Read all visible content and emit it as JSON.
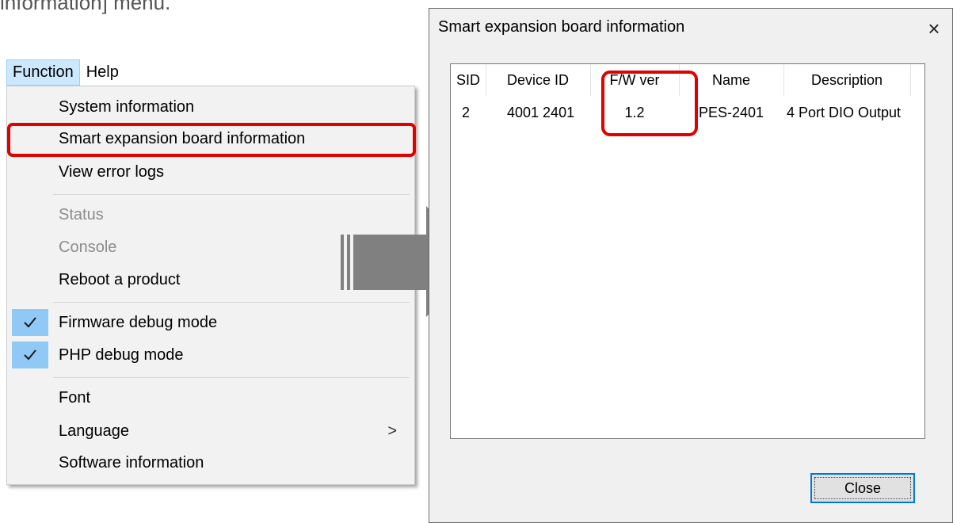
{
  "caption": "information] menu.",
  "menubar": {
    "items": [
      "Function",
      "Help"
    ]
  },
  "menu": {
    "items": [
      {
        "label": "System information",
        "enabled": true
      },
      {
        "label": "Smart expansion board information",
        "enabled": true,
        "highlighted": true
      },
      {
        "label": "View error logs",
        "enabled": true
      },
      {
        "label": "Status",
        "enabled": false
      },
      {
        "label": "Console",
        "enabled": false
      },
      {
        "label": "Reboot a product",
        "enabled": true
      },
      {
        "label": "Firmware debug mode",
        "enabled": true,
        "checked": true
      },
      {
        "label": "PHP debug mode",
        "enabled": true,
        "checked": true
      },
      {
        "label": "Font",
        "enabled": true
      },
      {
        "label": "Language",
        "enabled": true,
        "submenu_chevron": ">"
      },
      {
        "label": "Software information",
        "enabled": true
      }
    ]
  },
  "dialog": {
    "title": "Smart expansion board information",
    "close_glyph": "×",
    "columns": [
      "SID",
      "Device ID",
      "F/W ver",
      "Name",
      "Description"
    ],
    "rows": [
      [
        "2",
        "4001 2401",
        "1.2",
        "PES-2401",
        "4 Port DIO Output"
      ]
    ],
    "close_button": "Close"
  },
  "colors": {
    "highlight_red": "#e00000",
    "menu_check_bg": "#90c8f6",
    "menubar_active_bg": "#cce8ff",
    "arrow_gray": "#808080",
    "button_focus_border": "#0078d7"
  }
}
